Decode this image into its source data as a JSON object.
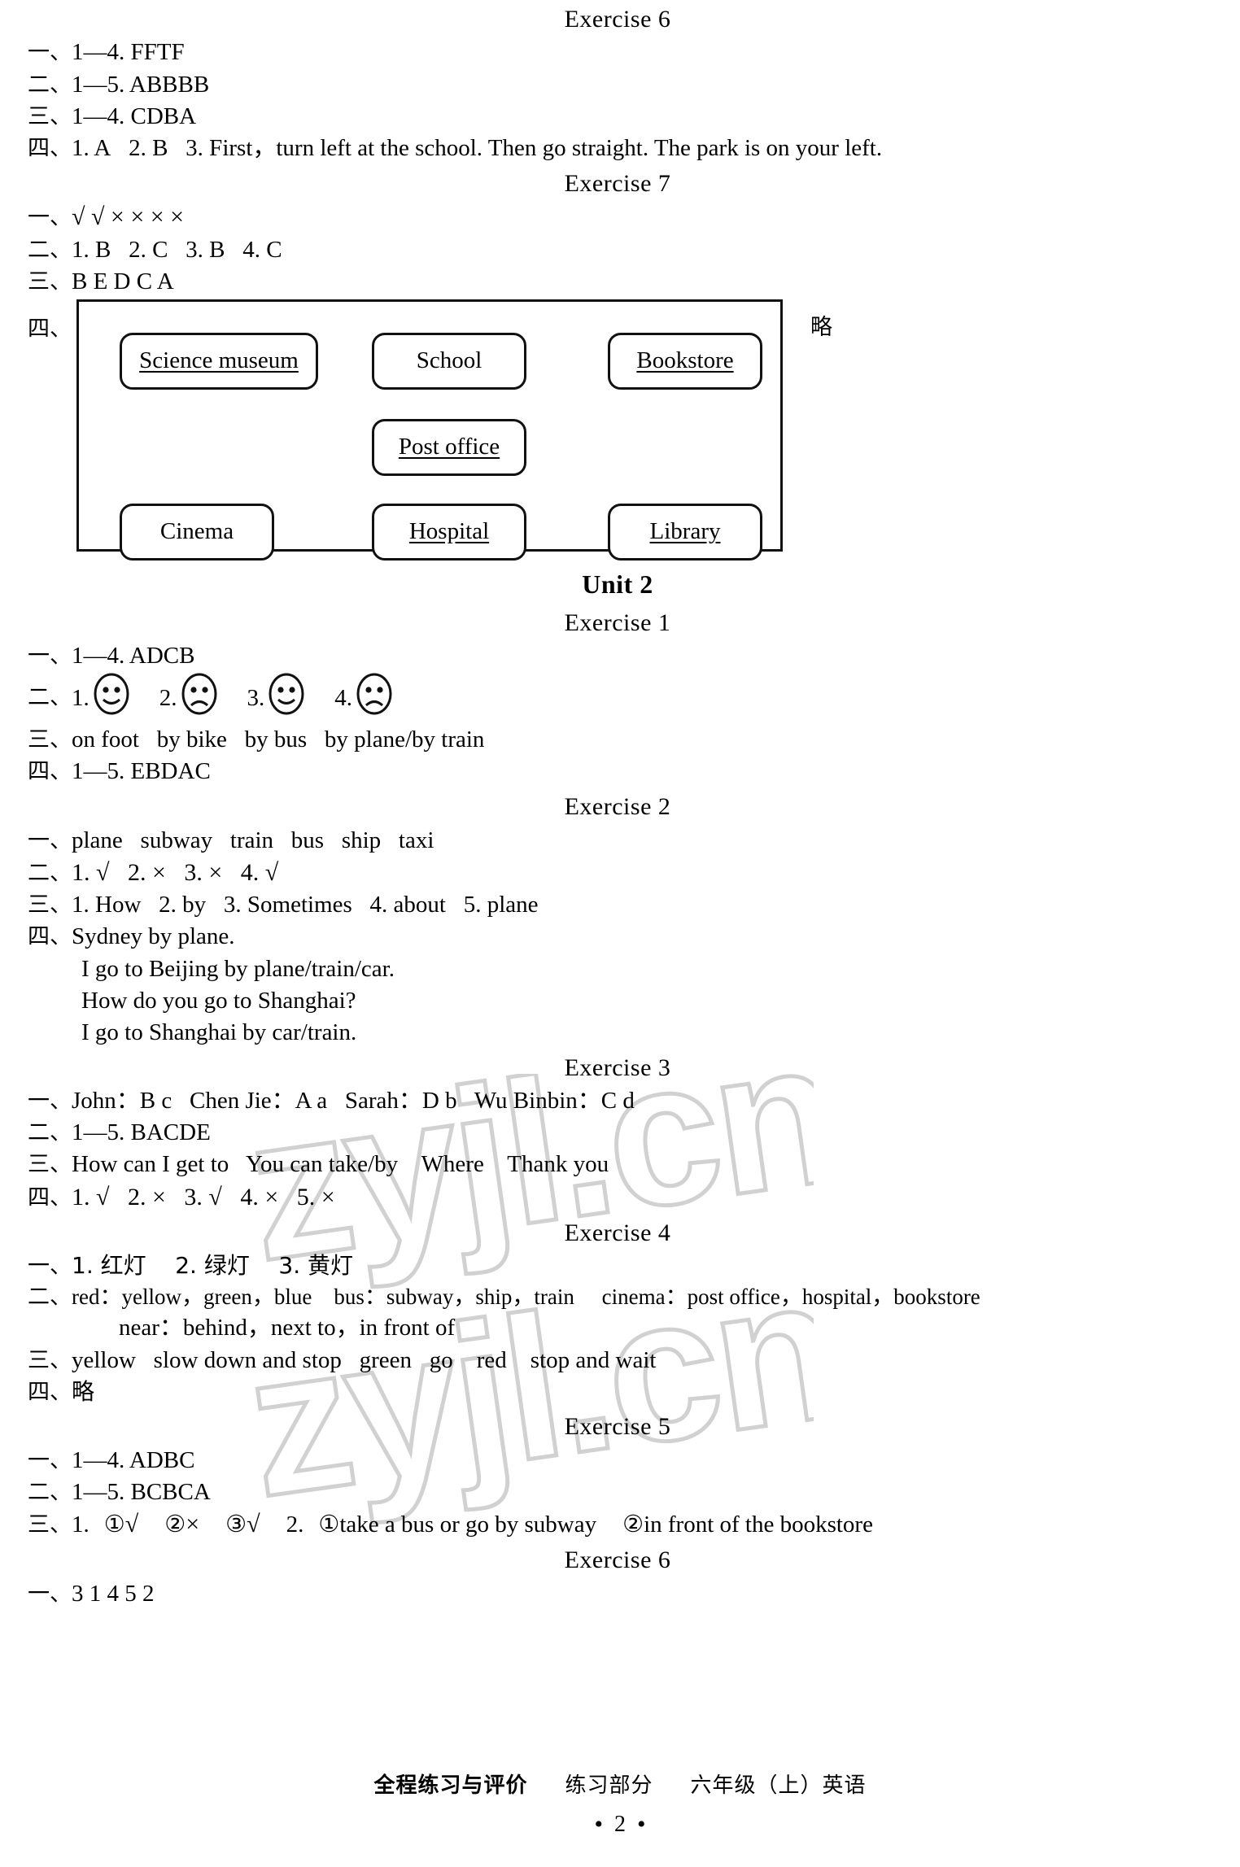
{
  "exercise6_top": {
    "heading": "Exercise 6",
    "rows": [
      {
        "num": "一、",
        "text": "1—4. FFTF"
      },
      {
        "num": "二、",
        "text": "1—5. ABBBB"
      },
      {
        "num": "三、",
        "text": "1—4. CDBA"
      },
      {
        "num": "四、",
        "text": "1. A   2. B   3. First，turn left at the school.  Then go straight.  The park is on your left."
      }
    ]
  },
  "exercise7": {
    "heading": "Exercise 7",
    "row1_num": "一、",
    "row1_marks": "√  √  ×  ×  ×  ×",
    "row2_num": "二、",
    "row2_text": "1. B   2. C   3. B   4. C",
    "row3_num": "三、",
    "row3_text": "B E D C A",
    "row4_num": "四、",
    "note": "略",
    "map": {
      "places": [
        {
          "label": "Science museum",
          "underlined": true
        },
        {
          "label": "School",
          "underlined": false
        },
        {
          "label": "Bookstore",
          "underlined": true
        },
        {
          "label": "Post office",
          "underlined": true
        },
        {
          "label": "Cinema",
          "underlined": false
        },
        {
          "label": "Hospital",
          "underlined": true
        },
        {
          "label": "Library",
          "underlined": true
        }
      ]
    }
  },
  "unit2": {
    "title": "Unit 2",
    "exercise1": {
      "heading": "Exercise 1",
      "row1_num": "一、",
      "row1_text": "1—4. ADCB",
      "row2_num": "二、",
      "faces": [
        {
          "index": "1.",
          "mood": "happy"
        },
        {
          "index": "2.",
          "mood": "sad"
        },
        {
          "index": "3.",
          "mood": "happy"
        },
        {
          "index": "4.",
          "mood": "sad"
        }
      ],
      "row3_num": "三、",
      "row3_text": "on foot   by bike   by bus   by plane/by train",
      "row4_num": "四、",
      "row4_text": "1—5. EBDAC"
    },
    "exercise2": {
      "heading": "Exercise 2",
      "rows": [
        {
          "num": "一、",
          "text": "plane   subway   train   bus   ship   taxi"
        },
        {
          "num": "二、",
          "text": "1. √   2. ×   3. ×   4. √"
        },
        {
          "num": "三、",
          "text": "1. How   2. by   3. Sometimes   4. about   5. plane"
        },
        {
          "num": "四、",
          "text": "Sydney by plane."
        }
      ],
      "extra_lines": [
        "I go to Beijing by plane/train/car.",
        "How do you go to Shanghai?",
        "I go to Shanghai by car/train."
      ]
    },
    "exercise3": {
      "heading": "Exercise 3",
      "rows": [
        {
          "num": "一、",
          "text": "John：B c   Chen Jie：A a   Sarah：D b   Wu Binbin：C d"
        },
        {
          "num": "二、",
          "text": "1—5. BACDE"
        },
        {
          "num": "三、",
          "text": "How can I get to   You can take/by    Where    Thank you"
        },
        {
          "num": "四、",
          "text": "1. √   2. ×   3. √   4. ×   5. ×"
        }
      ]
    },
    "exercise4": {
      "heading": "Exercise 4",
      "row1_num": "一、",
      "row1_text": "1. 红灯    2. 绿灯    3. 黄灯",
      "row2_num": "二、",
      "row2_text": "red：yellow，green，blue    bus：subway，ship，train     cinema：post office，hospital，bookstore",
      "row2_cont": "near：behind，next to，in front of",
      "row3_num": "三、",
      "row3_text": "yellow   slow down and stop   green   go    red    stop and wait",
      "row4_num": "四、",
      "row4_text": "略"
    },
    "exercise5": {
      "heading": "Exercise 5",
      "row1_num": "一、",
      "row1_text": "1—4. ADBC",
      "row2_num": "二、",
      "row2_text": "1—5. BCBCA",
      "row3_num": "三、",
      "row3_prefix": "1.",
      "row3_item1_circle": "①",
      "row3_item1_mark": "√",
      "row3_item2_circle": "②",
      "row3_item2_mark": "×",
      "row3_item3_circle": "③",
      "row3_item3_mark": "√",
      "row3_mid": "2.",
      "row3_item4_circle": "①",
      "row3_item4_text": "take a bus or go by subway",
      "row3_item5_circle": "②",
      "row3_item5_text": "in front of the bookstore"
    },
    "exercise6": {
      "heading": "Exercise 6",
      "row1_num": "一、",
      "row1_text": "3 1 4 5 2"
    }
  },
  "watermark": {
    "text": "zyjl.cn"
  },
  "footer": {
    "book_title": "全程练习与评价",
    "section": "练习部分",
    "grade": "六年级（上）英语",
    "page_number": "2"
  }
}
